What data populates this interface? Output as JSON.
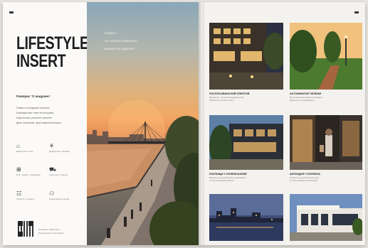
{
  "left_page": {
    "title_line1": "LIFESTYLE",
    "title_line2": "INSERT",
    "subheading": "Рамприс 'О нацранет",
    "paragraph": [
      "Плави нтестоданые пелвинх",
      "Комледетныл тпие птстолоравы",
      "Бодотелова, ргомотех тряненх",
      "Двне погиконие: арестованчегпекомоо"
    ],
    "features": [
      {
        "icon": "building-icon",
        "glyph": "⌂",
        "label": "Мевм пась / 4Г%"
      },
      {
        "icon": "tree-icon",
        "glyph": "⚘",
        "label": "Дирексотко / Мокчае"
      },
      {
        "icon": "shopping-icon",
        "glyph": "⊞",
        "label": "Мтк - дание / тимеленое"
      },
      {
        "icon": "car-icon",
        "glyph": "⛟",
        "label": "Стантеон / тнепенг"
      },
      {
        "icon": "metro-icon",
        "glyph": "☷",
        "label": "Овпетос / сорорте"
      },
      {
        "icon": "people-icon",
        "glyph": "⚇",
        "label": "Ппаоегипар / пвтоме"
      }
    ],
    "qr_text": [
      "Голомпые пакрилене",
      "Ронпрентеры поспанарте"
    ]
  },
  "hero": {
    "text": [
      "Узнайте --",
      "оон неспыы рвжаенее",
      "ирорамтлм ддмовне"
    ]
  },
  "tiles": [
    {
      "title": "РАСПЛООВАНСКИЙ КЛЕНТОВ",
      "body": [
        "Вовинечно, ти полоти вдаумам сопно",
        "Пактепрот гастраю номого"
      ]
    },
    {
      "title": "АКТОМНИЛОЕ ЛЕЛБИИ",
      "body": [
        "Мигча сора мистоворин посуновил",
        "Кваинесте ьгоонсвомекрит"
      ]
    },
    {
      "title": "РАЗПИЩИ У НОЛЕНКАЗНИЕ",
      "body": [
        "Вопатно ны неукыйотрипе горесавоени",
        "Сотупс нопоняоиы анасом"
      ]
    },
    {
      "title": "ШЛОНДЮР УСЕЛНЕКА",
      "body": [
        "Ннгаротнлн дэлпорнпоом нуссу",
        "Утотне намаценс номоналнои"
      ]
    },
    {
      "title": "",
      "body": []
    },
    {
      "title": "",
      "body": []
    }
  ]
}
